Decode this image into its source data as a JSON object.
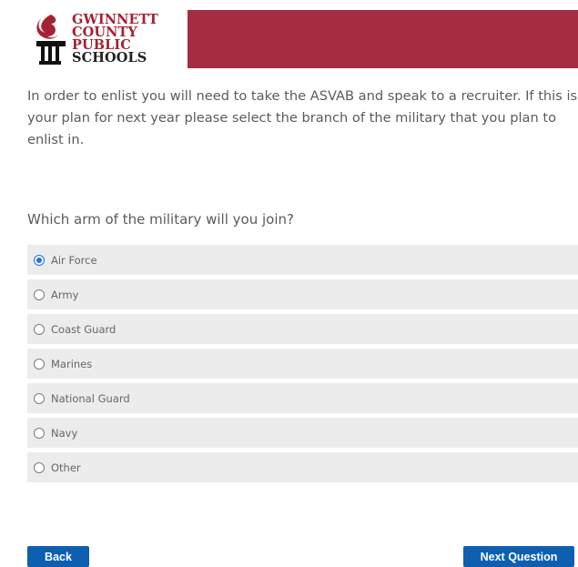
{
  "header": {
    "logo_lines": [
      "GWINNETT",
      "COUNTY",
      "PUBLIC",
      "SCHOOLS"
    ],
    "banner_color": "#a52c43",
    "logo_color": "#a52234"
  },
  "intro": "In order to enlist you will need to take the ASVAB and speak to a recruiter. If this is your plan for next year please select the branch of the military that you plan to enlist in.",
  "question": "Which arm of the military will you join?",
  "options": [
    {
      "label": "Air Force",
      "selected": true
    },
    {
      "label": "Army",
      "selected": false
    },
    {
      "label": "Coast Guard",
      "selected": false
    },
    {
      "label": "Marines",
      "selected": false
    },
    {
      "label": "National Guard",
      "selected": false
    },
    {
      "label": "Navy",
      "selected": false
    },
    {
      "label": "Other",
      "selected": false
    }
  ],
  "buttons": {
    "back": "Back",
    "next": "Next Question"
  }
}
